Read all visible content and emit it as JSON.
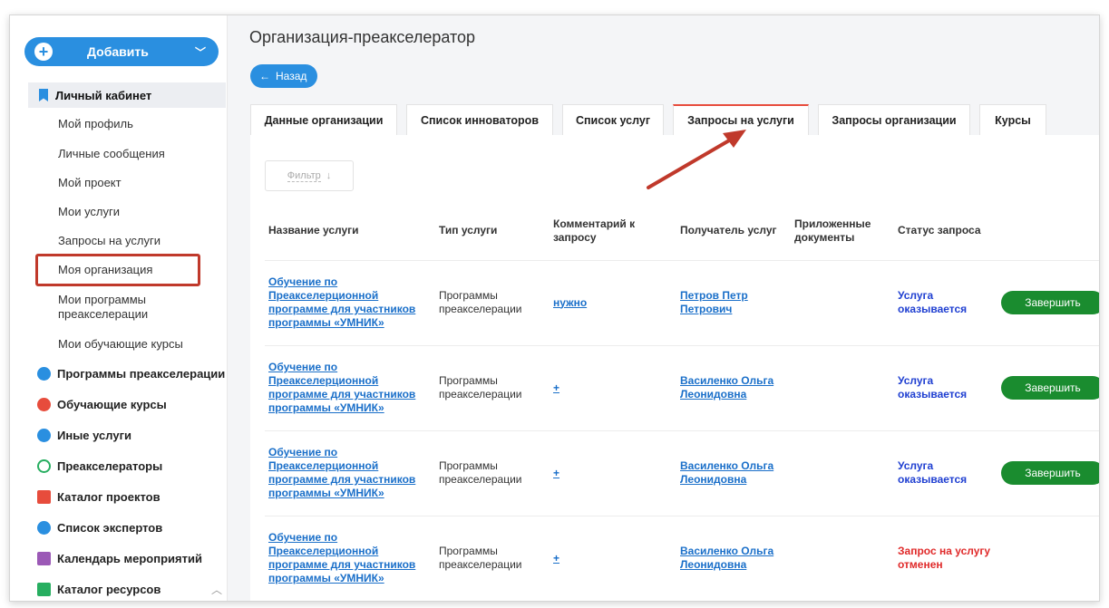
{
  "sidebar": {
    "add_label": "Добавить",
    "cabinet_label": "Личный кабинет",
    "sub_items": [
      "Мой профиль",
      "Личные сообщения",
      "Мой проект",
      "Мои услуги",
      "Запросы на услуги",
      "Моя организация",
      "Мои программы преакселерации",
      "Мои обучающие курсы"
    ],
    "categories": [
      "Программы преакселерации",
      "Обучающие курсы",
      "Иные услуги",
      "Преакселераторы",
      "Каталог проектов",
      "Список экспертов",
      "Календарь мероприятий",
      "Каталог ресурсов"
    ]
  },
  "page": {
    "title": "Организация-преакселератор",
    "back_label": "Назад",
    "tabs": [
      "Данные организации",
      "Список инноваторов",
      "Список услуг",
      "Запросы на услуги",
      "Запросы организации",
      "Курсы"
    ],
    "filter_label": "Фильтр"
  },
  "table": {
    "headers": [
      "Название услуги",
      "Тип услуги",
      "Комментарий к запросу",
      "Получатель услуг",
      "Приложенные документы",
      "Статус запроса"
    ],
    "rows": [
      {
        "service": "Обучение по Преакселерционной программе для участников программы «УМНИК»",
        "type": "Программы преакселерации",
        "comment": "нужно",
        "recipient": "Петров Петр Петрович",
        "docs": "",
        "status": "Услуга оказывается",
        "action": "Завершить"
      },
      {
        "service": "Обучение по Преакселерционной программе для участников программы «УМНИК»",
        "type": "Программы преакселерации",
        "comment": "+",
        "recipient": "Василенко Ольга Леонидовна",
        "docs": "",
        "status": "Услуга оказывается",
        "action": "Завершить"
      },
      {
        "service": "Обучение по Преакселерционной программе для участников программы «УМНИК»",
        "type": "Программы преакселерации",
        "comment": "+",
        "recipient": "Василенко Ольга Леонидовна",
        "docs": "",
        "status": "Услуга оказывается",
        "action": "Завершить"
      },
      {
        "service": "Обучение по Преакселерционной программе для участников программы «УМНИК»",
        "type": "Программы преакселерации",
        "comment": "+",
        "recipient": "Василенко Ольга Леонидовна",
        "docs": "",
        "status": "Запрос на услугу отменен",
        "action": ""
      }
    ]
  },
  "colors": {
    "accent": "#2a8fe0",
    "active_tab": "#e74c3c",
    "complete_button": "#1a8c2f",
    "status_ok": "#1f3fd1",
    "status_cancel": "#e02a2a",
    "annotation": "#c0392b"
  }
}
